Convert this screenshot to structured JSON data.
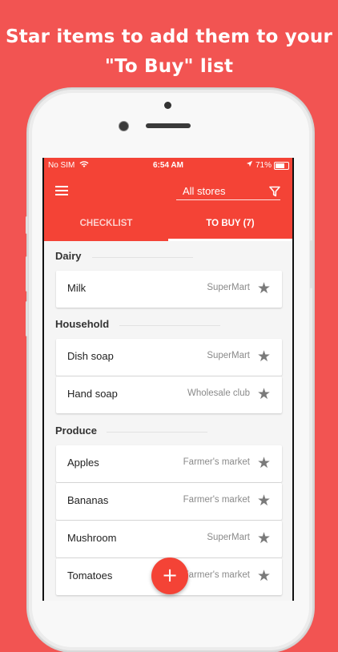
{
  "promo": {
    "line1": "Star items to add them to your",
    "line2": "\"To Buy\" list"
  },
  "status_bar": {
    "carrier": "No SIM",
    "time": "6:54 AM",
    "battery": "71%"
  },
  "app_bar": {
    "store_filter": "All stores",
    "tabs": [
      {
        "label": "CHECKLIST",
        "active": false
      },
      {
        "label": "TO BUY (7)",
        "active": true
      }
    ]
  },
  "sections": [
    {
      "title": "Dairy",
      "items": [
        {
          "name": "Milk",
          "store": "SuperMart",
          "starred": true
        }
      ]
    },
    {
      "title": "Household",
      "items": [
        {
          "name": "Dish soap",
          "store": "SuperMart",
          "starred": true
        },
        {
          "name": "Hand soap",
          "store": "Wholesale club",
          "starred": true
        }
      ]
    },
    {
      "title": "Produce",
      "items": [
        {
          "name": "Apples",
          "store": "Farmer's market",
          "starred": true
        },
        {
          "name": "Bananas",
          "store": "Farmer's market",
          "starred": true
        },
        {
          "name": "Mushroom",
          "store": "SuperMart",
          "starred": true
        },
        {
          "name": "Tomatoes",
          "store": "Farmer's market",
          "starred": true
        }
      ]
    }
  ],
  "fab": {
    "label": "+"
  },
  "icons": {
    "menu": "hamburger-menu-icon",
    "filter": "filter-icon",
    "star": "star-icon",
    "add": "plus-icon"
  },
  "colors": {
    "background": "#f25452",
    "primary": "#f44336",
    "star": "#7a7a7a"
  }
}
